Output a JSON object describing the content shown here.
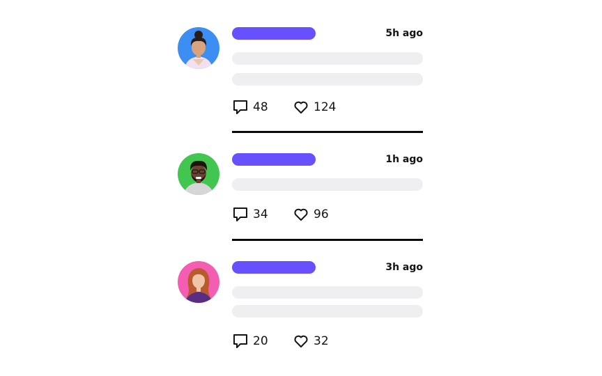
{
  "colors": {
    "accent": "#6650ff",
    "placeholder": "#efeff2",
    "divider": "#0a0a0a",
    "avatar_backgrounds": [
      "#3d8ef2",
      "#43c64f",
      "#f35eb3"
    ]
  },
  "icons": {
    "comment": "speech-bubble-outline",
    "like": "heart-outline"
  },
  "posts": [
    {
      "time": "5h ago",
      "comments": "48",
      "likes": "124",
      "text_lines": 2
    },
    {
      "time": "1h ago",
      "comments": "34",
      "likes": "96",
      "text_lines": 1
    },
    {
      "time": "3h ago",
      "comments": "20",
      "likes": "32",
      "text_lines": 2
    }
  ]
}
